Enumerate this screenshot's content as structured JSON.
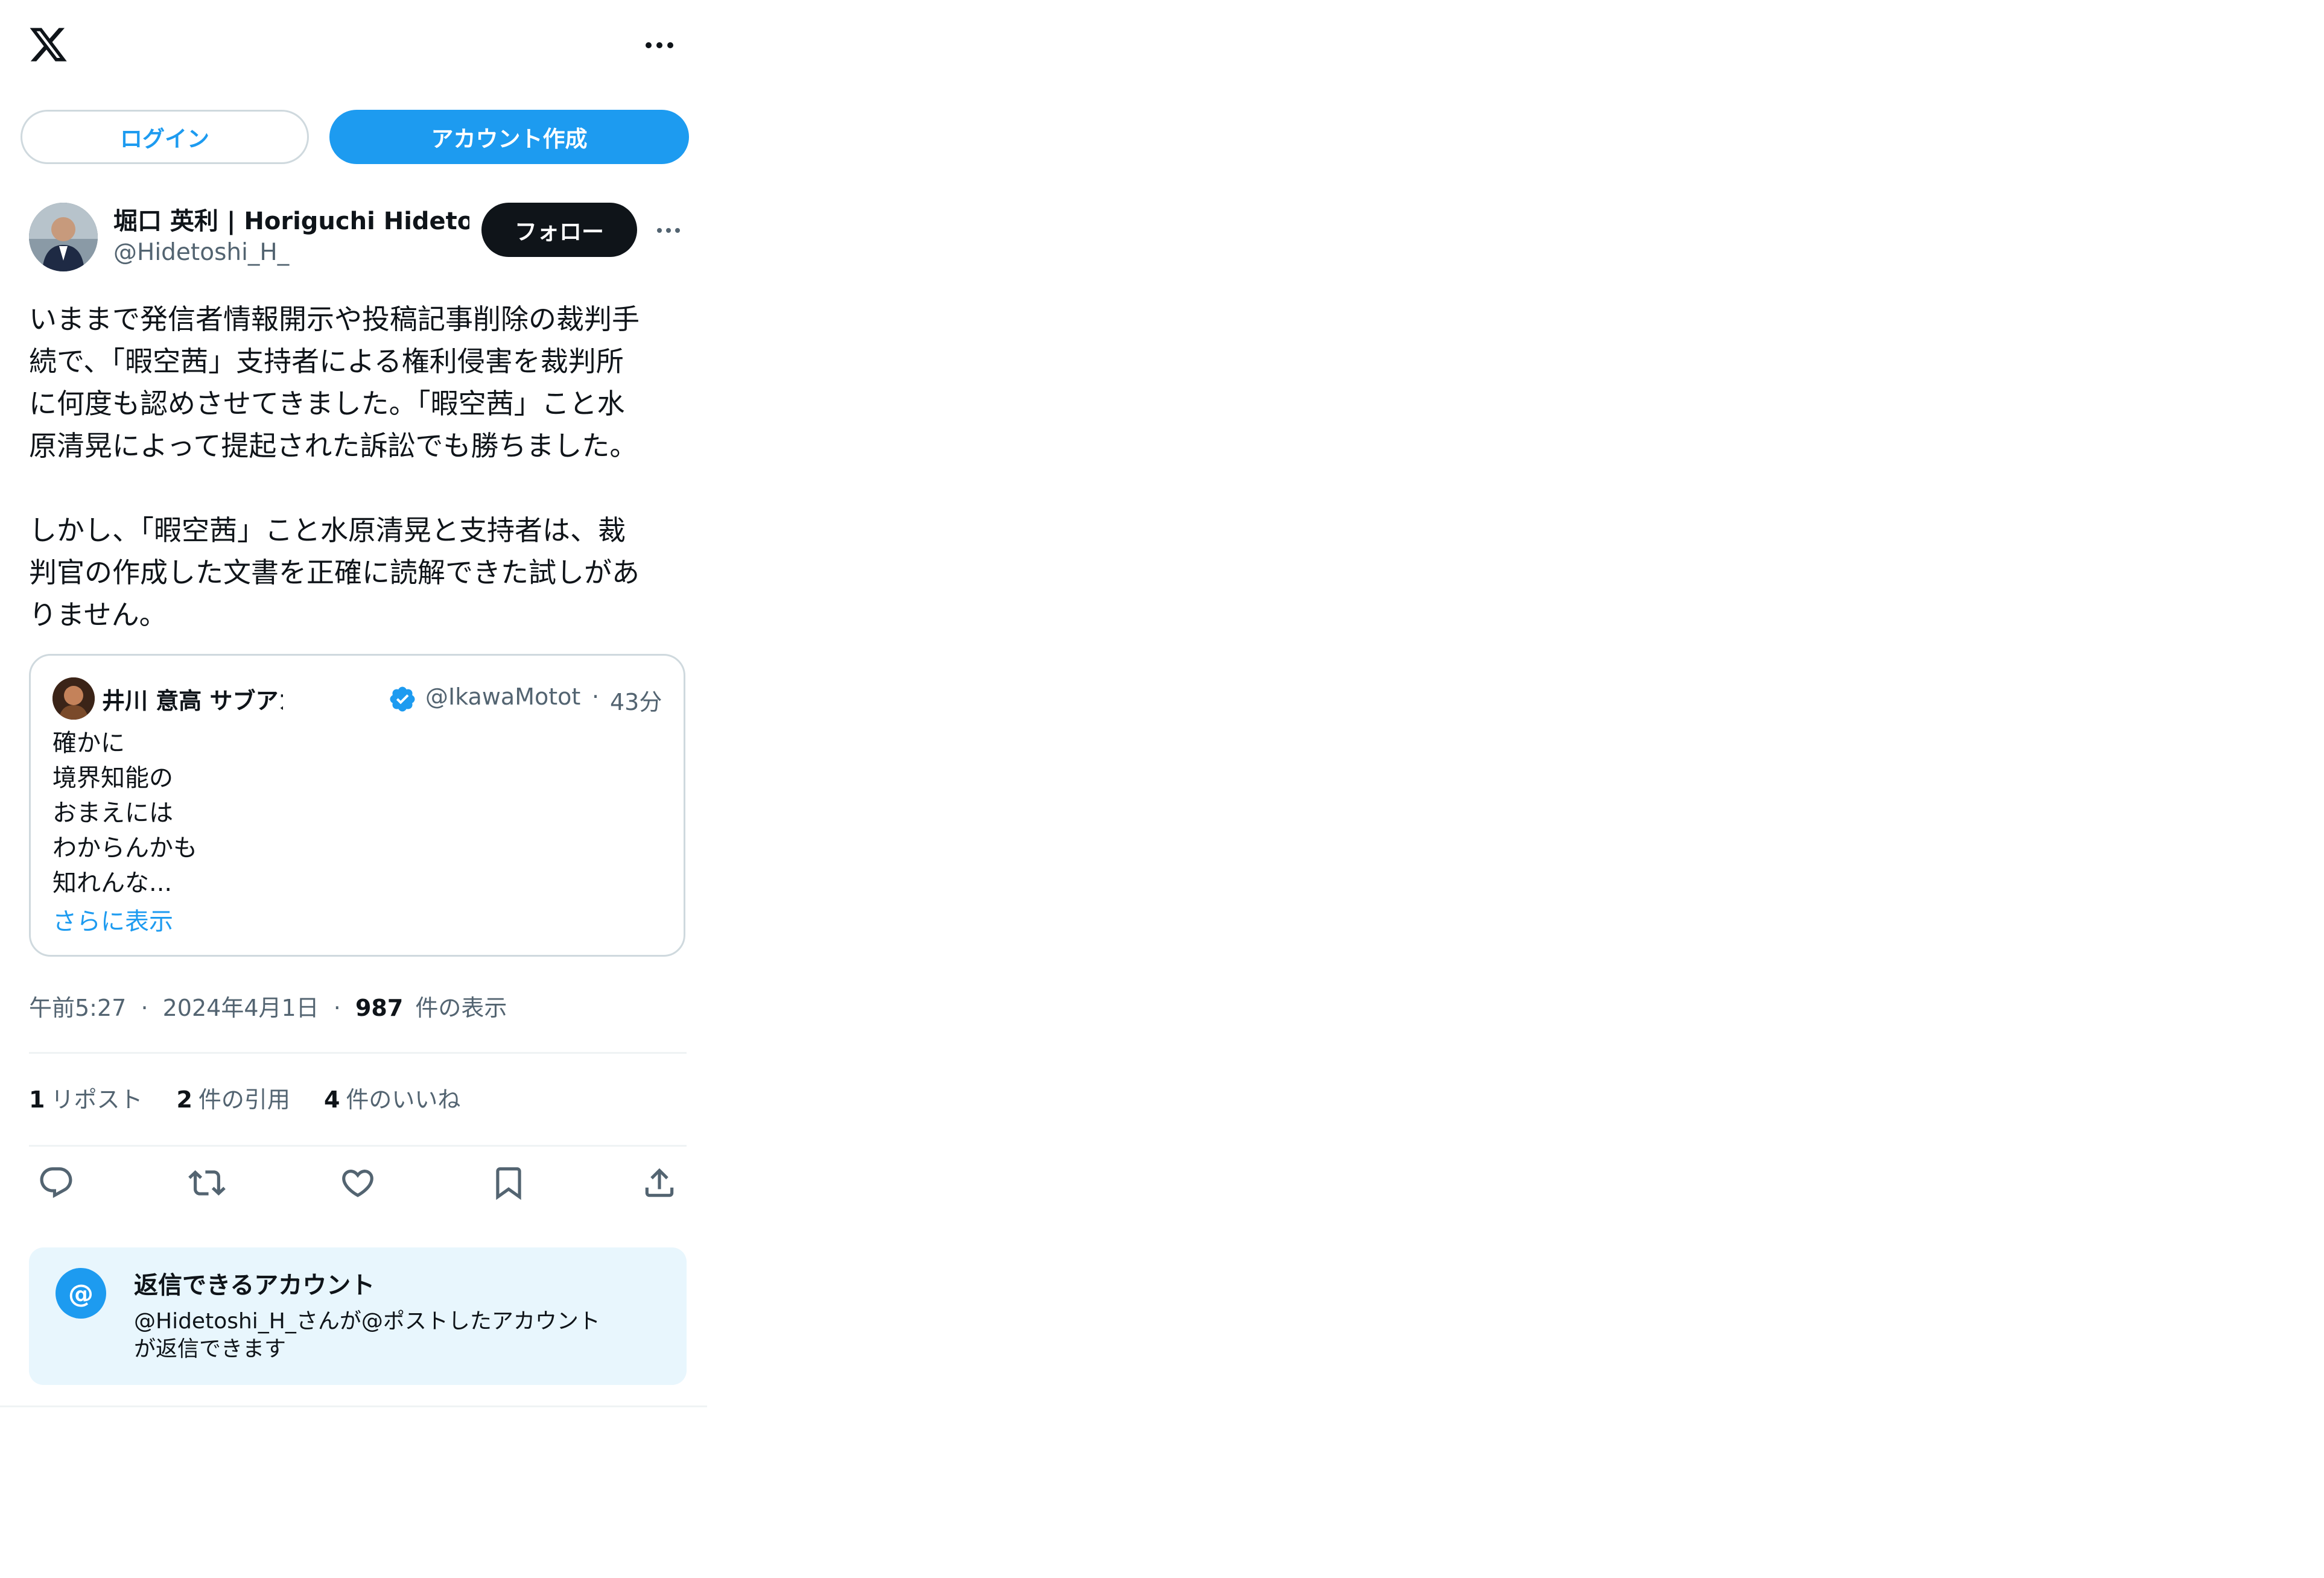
{
  "header": {
    "more_icon": "more-horizontal-icon",
    "logo_icon": "x-logo-icon"
  },
  "auth": {
    "login_label": "ログイン",
    "signup_label": "アカウント作成"
  },
  "author": {
    "name": "堀口 英利 | Horiguchi Hidetoshi",
    "handle": "@Hidetoshi_H_",
    "follow_label": "フォロー"
  },
  "tweet": {
    "text": "いままで発信者情報開示や投稿記事削除の裁判手\n続で、「暇空茜」支持者による権利侵害を裁判所\nに何度も認めさせてきました。「暇空茜」こと水\n原清晃によって提起された訴訟でも勝ちました。\n\nしかし、「暇空茜」こと水原清晃と支持者は、裁\n判官の作成した文書を正確に読解できた試しがあ\nりません。"
  },
  "quote": {
    "name": "井川 意高 サブアカ改めオ",
    "handle": "@IkawaMotot",
    "time": "43分",
    "separator": "·",
    "text": "確かに\n境界知能の\nおまえには\nわからんかも\n知れんな...",
    "show_more": "さらに表示"
  },
  "meta": {
    "time": "午前5:27",
    "sep1": "·",
    "date": "2024年4月1日",
    "sep2": "·",
    "views_count": "987",
    "views_label": "件の表示"
  },
  "stats": {
    "reposts_count": "1",
    "reposts_label": "リポスト",
    "quotes_count": "2",
    "quotes_label": "件の引用",
    "likes_count": "4",
    "likes_label": "件のいいね"
  },
  "actions": [
    "reply-icon",
    "repost-icon",
    "like-icon",
    "bookmark-icon",
    "share-icon"
  ],
  "reply_restriction": {
    "icon": "@",
    "title": "返信できるアカウント",
    "desc": "@Hidetoshi_H_さんが@ポストしたアカウント\nが返信できます"
  },
  "colors": {
    "accent": "#1d9bf0",
    "text": "#0f1419",
    "muted": "#536471",
    "border": "#cfd9de"
  }
}
